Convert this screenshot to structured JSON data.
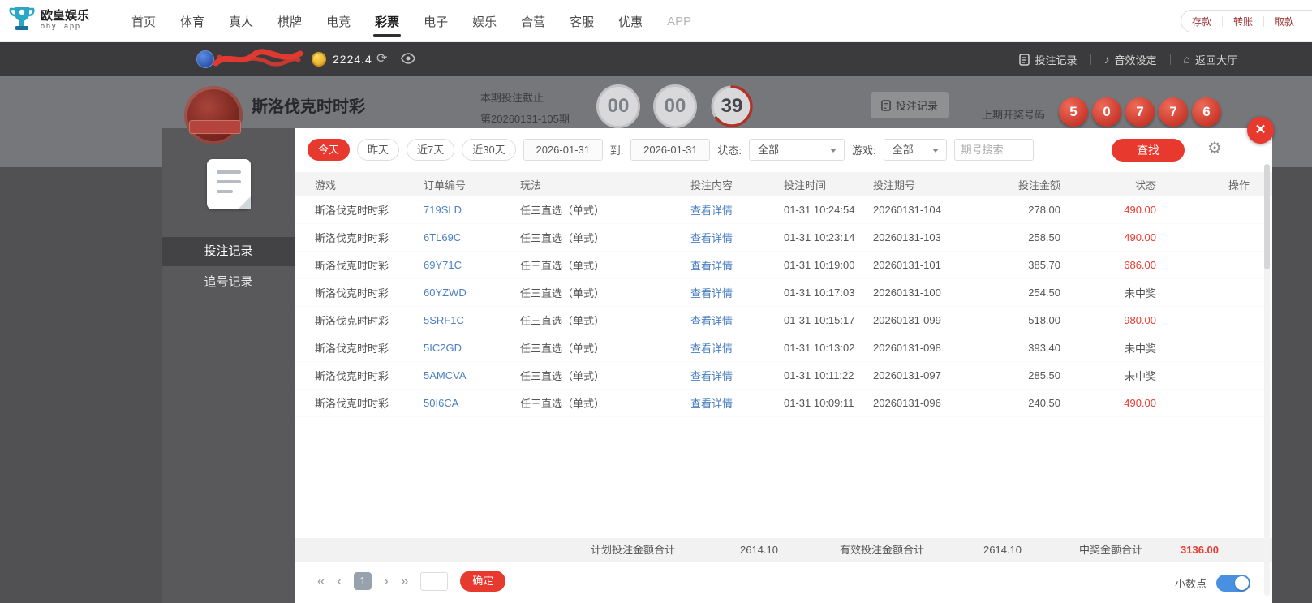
{
  "colors": {
    "accent": "#e8392f",
    "link": "#4a7fc0",
    "toggle_on": "#4a90e2"
  },
  "icons": {
    "refresh": "⟳",
    "gear": "⚙",
    "music": "♪",
    "home": "⌂",
    "close": "×"
  },
  "brand": {
    "name": "欧皇娱乐",
    "domain": "ohyl.app"
  },
  "top_nav": {
    "items": [
      "首页",
      "体育",
      "真人",
      "棋牌",
      "电竞",
      "彩票",
      "电子",
      "娱乐",
      "合营",
      "客服",
      "优惠",
      "APP"
    ],
    "active": "彩票",
    "wallet": [
      "存款",
      "转账",
      "取款"
    ]
  },
  "user_bar": {
    "balance": "2224.4",
    "actions": [
      {
        "label": "投注记录"
      },
      {
        "label": "音效设定"
      },
      {
        "label": "返回大厅"
      }
    ]
  },
  "game_header": {
    "title": "斯洛伐克时时彩",
    "deadline_label": "本期投注截止",
    "period": "第20260131-105期",
    "countdown": [
      "00",
      "00",
      "39"
    ],
    "record_button": "投注记录",
    "last_draw_label": "上期开奖号码",
    "last_draw": [
      "5",
      "0",
      "7",
      "7",
      "6"
    ]
  },
  "modal": {
    "sidebar": {
      "items": [
        "投注记录",
        "追号记录"
      ],
      "active": "投注记录"
    },
    "filters": {
      "quick": [
        "今天",
        "昨天",
        "近7天",
        "近30天"
      ],
      "active_quick": "今天",
      "date_from": "2026-01-31",
      "to_label": "到:",
      "date_to": "2026-01-31",
      "status_label": "状态:",
      "status_value": "全部",
      "game_label": "游戏:",
      "game_value": "全部",
      "period_placeholder": "期号搜索",
      "search_label": "查找"
    },
    "table": {
      "headers": [
        "游戏",
        "订单编号",
        "玩法",
        "投注内容",
        "投注时间",
        "投注期号",
        "投注金额",
        "状态",
        "操作"
      ],
      "detail_label": "查看详情",
      "rows": [
        {
          "game": "斯洛伐克时时彩",
          "order": "719SLD",
          "play": "任三直选（单式）",
          "time": "01-31 10:24:54",
          "period": "20260131-104",
          "amount": "278.00",
          "status": "490.00",
          "status_class": "win"
        },
        {
          "game": "斯洛伐克时时彩",
          "order": "6TL69C",
          "play": "任三直选（单式）",
          "time": "01-31 10:23:14",
          "period": "20260131-103",
          "amount": "258.50",
          "status": "490.00",
          "status_class": "win"
        },
        {
          "game": "斯洛伐克时时彩",
          "order": "69Y71C",
          "play": "任三直选（单式）",
          "time": "01-31 10:19:00",
          "period": "20260131-101",
          "amount": "385.70",
          "status": "686.00",
          "status_class": "win"
        },
        {
          "game": "斯洛伐克时时彩",
          "order": "60YZWD",
          "play": "任三直选（单式）",
          "time": "01-31 10:17:03",
          "period": "20260131-100",
          "amount": "254.50",
          "status": "未中奖",
          "status_class": "plain"
        },
        {
          "game": "斯洛伐克时时彩",
          "order": "5SRF1C",
          "play": "任三直选（单式）",
          "time": "01-31 10:15:17",
          "period": "20260131-099",
          "amount": "518.00",
          "status": "980.00",
          "status_class": "win"
        },
        {
          "game": "斯洛伐克时时彩",
          "order": "5IC2GD",
          "play": "任三直选（单式）",
          "time": "01-31 10:13:02",
          "period": "20260131-098",
          "amount": "393.40",
          "status": "未中奖",
          "status_class": "plain"
        },
        {
          "game": "斯洛伐克时时彩",
          "order": "5AMCVA",
          "play": "任三直选（单式）",
          "time": "01-31 10:11:22",
          "period": "20260131-097",
          "amount": "285.50",
          "status": "未中奖",
          "status_class": "plain"
        },
        {
          "game": "斯洛伐克时时彩",
          "order": "50I6CA",
          "play": "任三直选（单式）",
          "time": "01-31 10:09:11",
          "period": "20260131-096",
          "amount": "240.50",
          "status": "490.00",
          "status_class": "win"
        }
      ]
    },
    "summary": {
      "plan_label": "计划投注金额合计",
      "plan_value": "2614.10",
      "valid_label": "有效投注金额合计",
      "valid_value": "2614.10",
      "win_label": "中奖金额合计",
      "win_value": "3136.00"
    },
    "pagination": {
      "first": "«",
      "prev": "‹",
      "page": "1",
      "next": "›",
      "last": "»",
      "confirm_label": "确定",
      "decimal_label": "小数点"
    }
  }
}
